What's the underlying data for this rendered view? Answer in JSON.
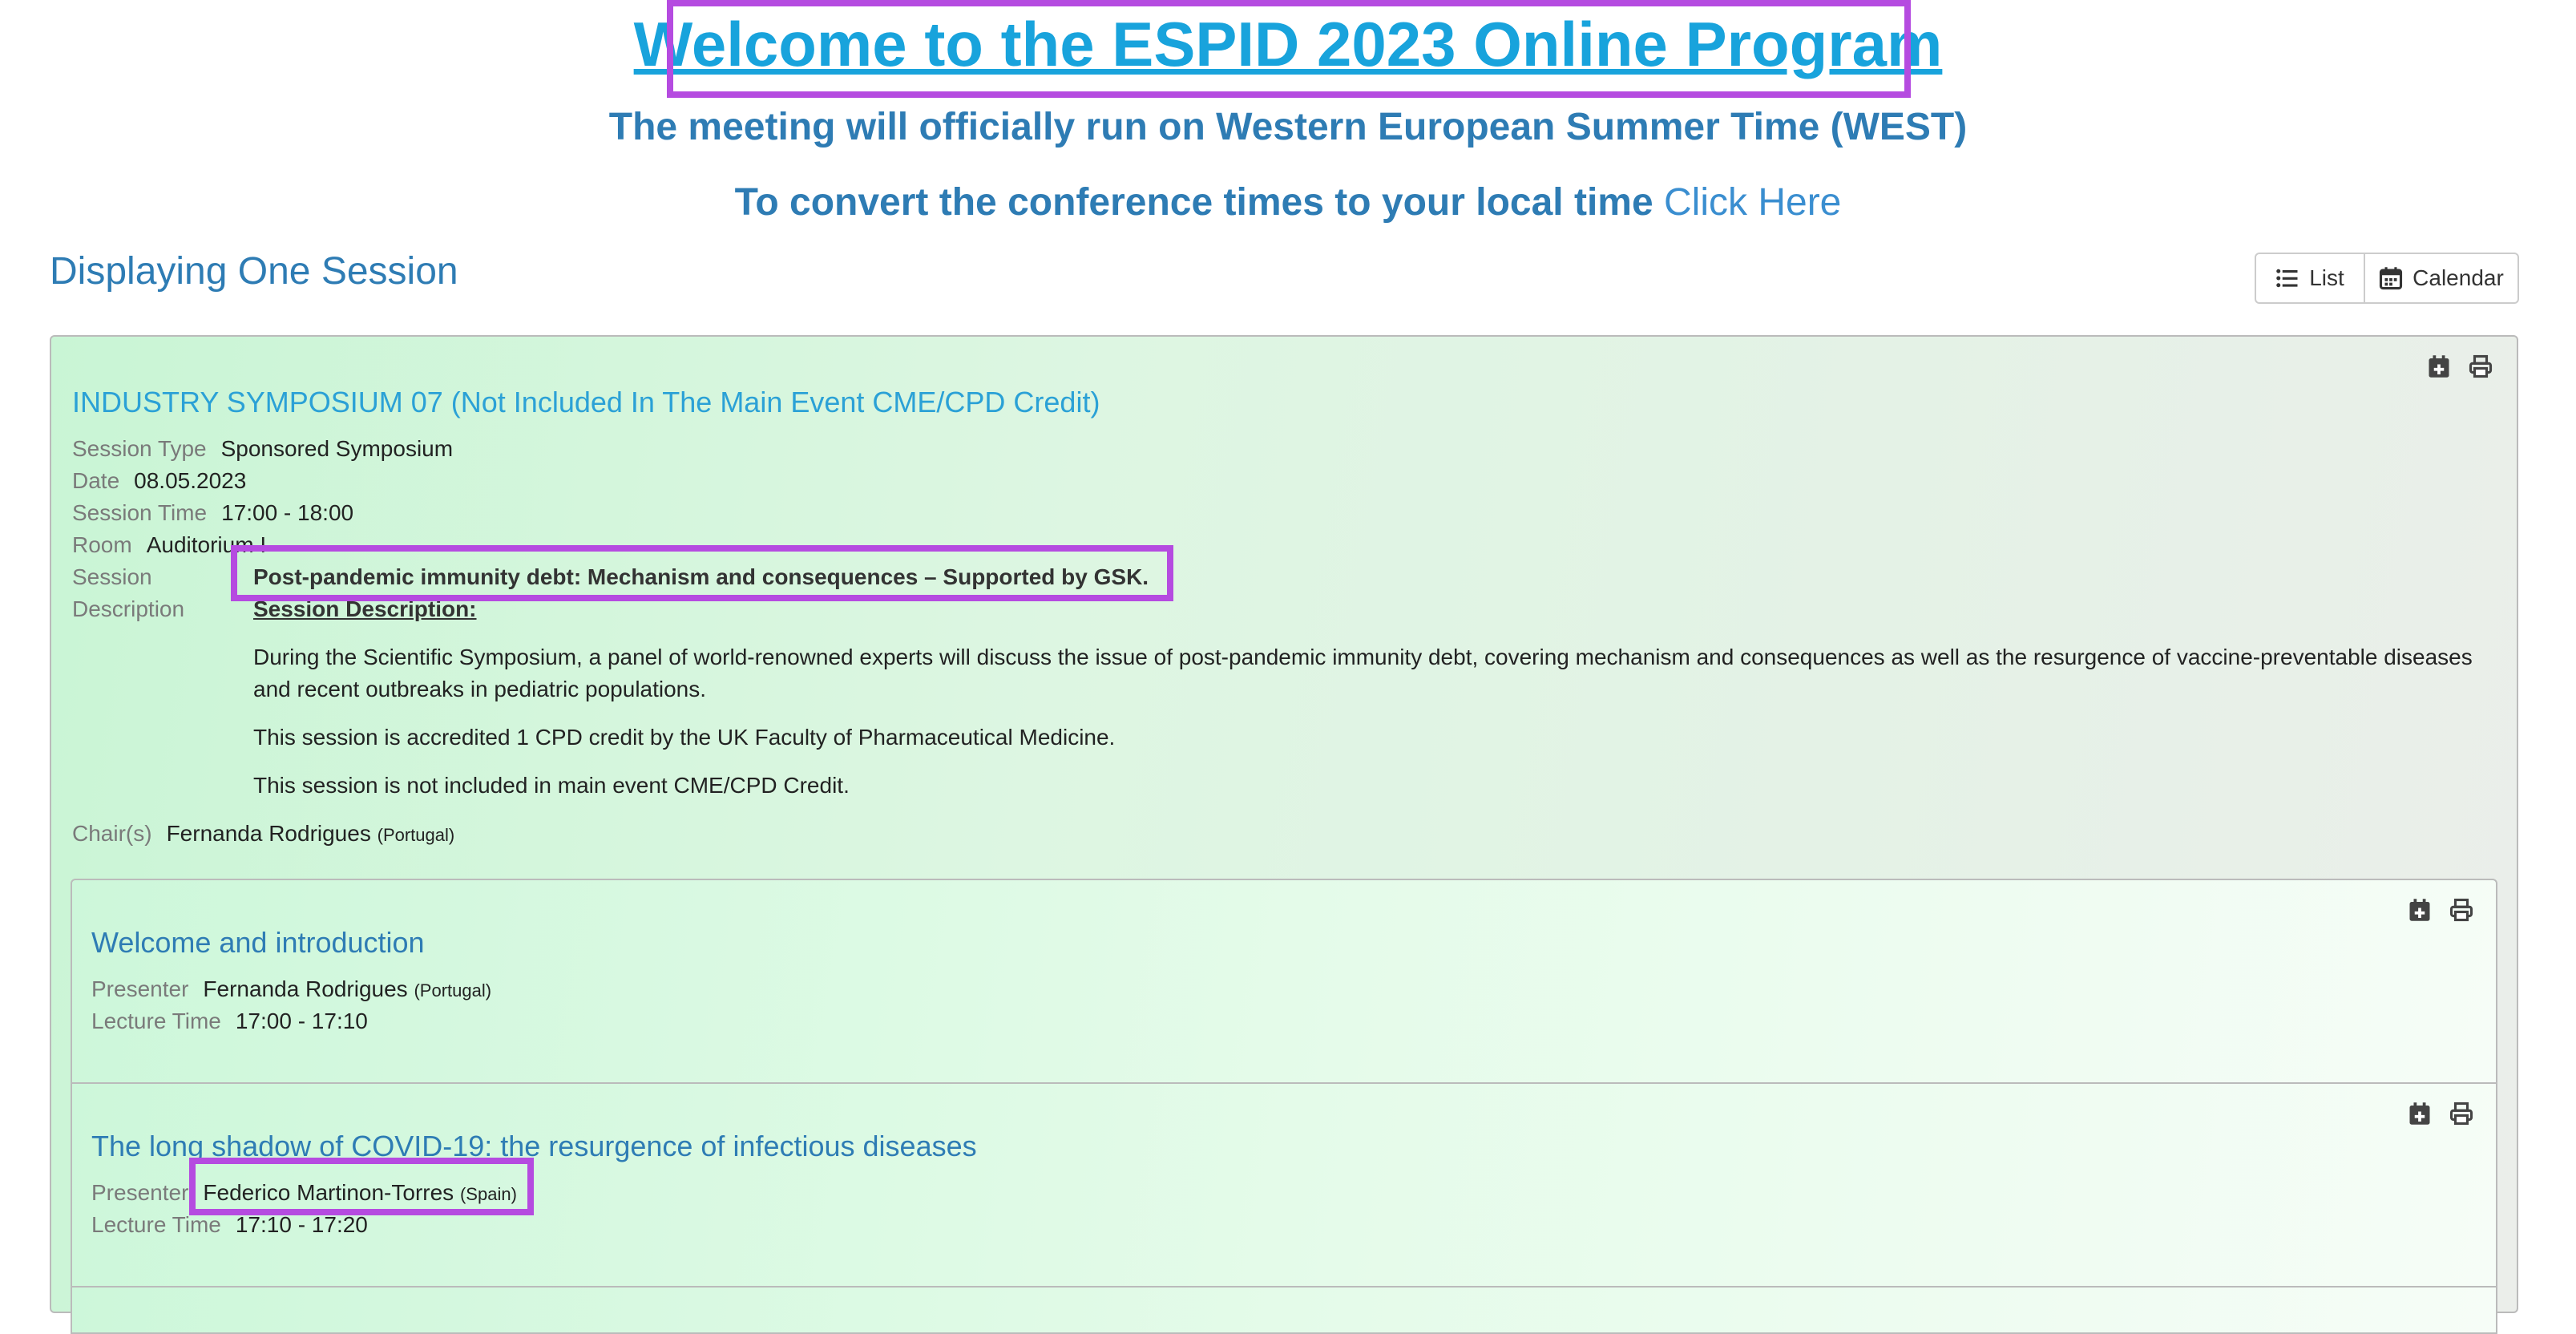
{
  "header": {
    "title": "Welcome to the ESPID 2023 Online Program",
    "timezone_note": "The meeting will officially run on Western European Summer Time (WEST)",
    "convert_prefix": "To convert the conference times to your local time",
    "convert_link": "Click Here"
  },
  "listing": {
    "title": "Displaying One Session",
    "view_list": "List",
    "view_calendar": "Calendar"
  },
  "session": {
    "title": "INDUSTRY SYMPOSIUM 07 (Not Included In The Main Event CME/CPD Credit)",
    "type_label": "Session Type",
    "type_value": "Sponsored Symposium",
    "date_label": "Date",
    "date_value": "08.05.2023",
    "time_label": "Session Time",
    "time_value": "17:00 - 18:00",
    "room_label": "Room",
    "room_value": "Auditorium I",
    "desc_label_1": "Session",
    "desc_label_2": "Description",
    "desc_heading": "Post-pandemic immunity debt: Mechanism and consequences – Supported by GSK.",
    "desc_subheading": "Session Description:",
    "desc_paragraphs": [
      "During the Scientific Symposium, a panel of world-renowned experts will discuss the issue of post-pandemic immunity debt, covering mechanism and consequences as well as the resurgence of vaccine-preventable diseases and recent outbreaks in pediatric populations.",
      "This session is accredited 1 CPD credit by the UK Faculty of Pharmaceutical Medicine.",
      "This session is not included in main event CME/CPD Credit."
    ],
    "chair_label": "Chair(s)",
    "chair_name": "Fernanda Rodrigues",
    "chair_country": "(Portugal)"
  },
  "lectures": [
    {
      "title": "Welcome and introduction",
      "presenter_label": "Presenter",
      "presenter_name": "Fernanda Rodrigues",
      "presenter_country": "(Portugal)",
      "time_label": "Lecture Time",
      "time_value": "17:00 - 17:10"
    },
    {
      "title": "The long shadow of COVID-19: the resurgence of infectious diseases",
      "presenter_label": "Presenter",
      "presenter_name": "Federico Martinon-Torres",
      "presenter_country": "(Spain)",
      "time_label": "Lecture Time",
      "time_value": "17:10 - 17:20"
    }
  ],
  "colors": {
    "highlight": "#b54be0",
    "title_blue": "#18a3dc",
    "heading_blue": "#2e7cb4"
  },
  "icons": [
    "list-icon",
    "calendar-icon",
    "calendar-plus-icon",
    "print-icon"
  ]
}
